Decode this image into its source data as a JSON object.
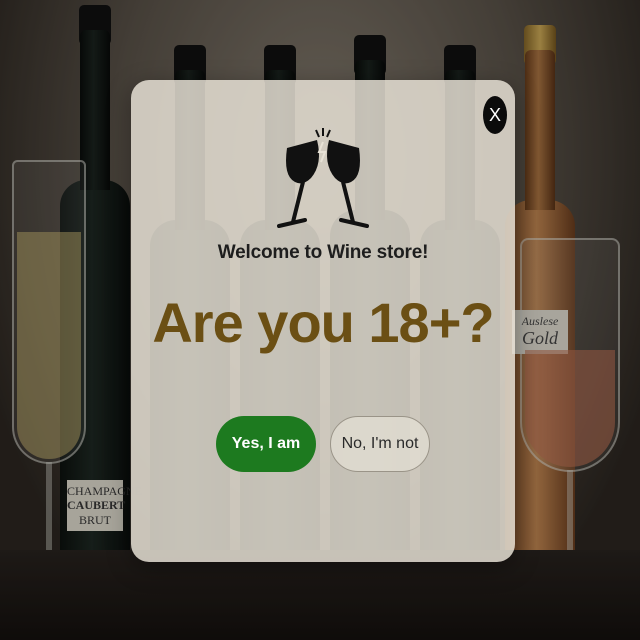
{
  "background": {
    "left_bottle_label": [
      "CHAMPAGNE",
      "CAUBERT",
      "BRUT"
    ],
    "right_bottle_label": [
      "Auslese",
      "Gold"
    ]
  },
  "modal": {
    "close_label": "X",
    "welcome": "Welcome to Wine store!",
    "question": "Are you 18+?",
    "yes_label": "Yes, I am",
    "no_label": "No, I'm not",
    "logo_icon": "wine-glasses-cheers-icon"
  },
  "colors": {
    "yes_button": "#1d7a1f",
    "question_text": "#6b4f14",
    "modal_bg": "#e8e2d6"
  }
}
